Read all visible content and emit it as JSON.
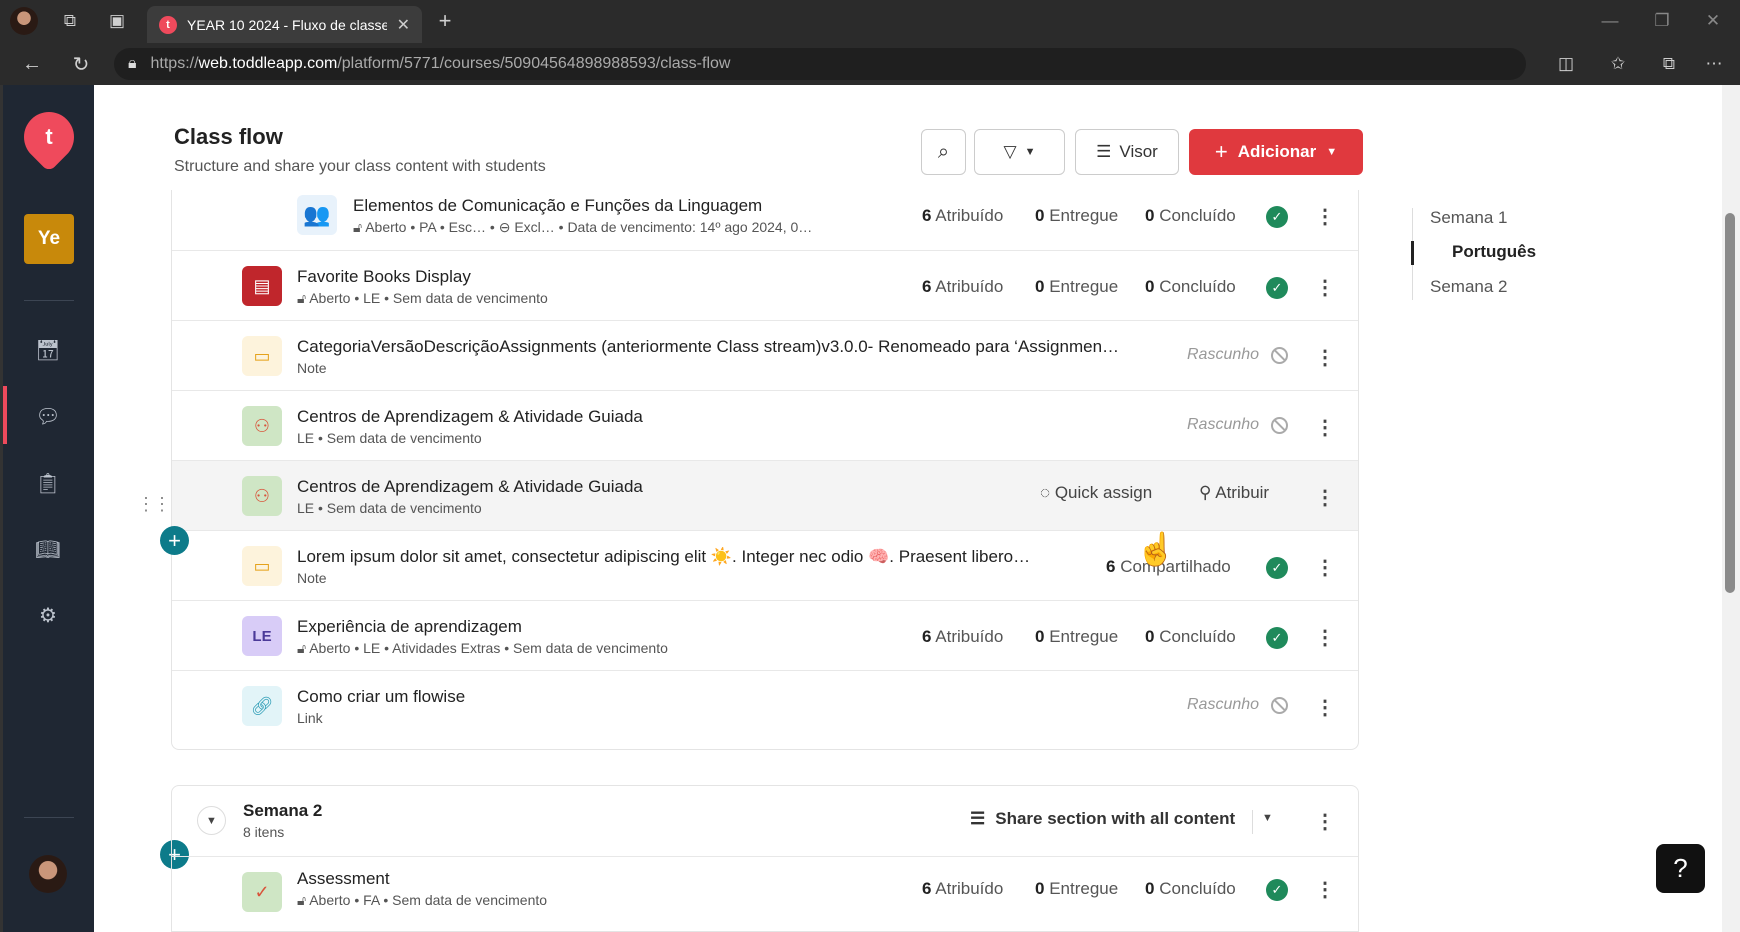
{
  "browser": {
    "tab_title": "YEAR 10 2024 - Fluxo de classe",
    "tab_favicon": "t",
    "url_prefix": "https://",
    "url_host": "web.toddleapp.com",
    "url_path": "/platform/5771/courses/50904564898988593/class-flow"
  },
  "sidebar": {
    "logo": "t",
    "course_badge": "Ye",
    "items": [
      "calendar-icon",
      "chat-icon",
      "person-doc-icon",
      "book-icon",
      "gear-icon"
    ]
  },
  "header": {
    "title": "Class flow",
    "subtitle": "Structure and share your class content with students",
    "visor_label": "Visor",
    "add_label": "Adicionar"
  },
  "rows": [
    {
      "title": "Elementos de Comunicação e Funções da Linguagem",
      "sub": "Aberto • PA • Esc… • ⊖ Excl… • Data de vencimento: 14º ago 2024, 0…",
      "assigned": "6",
      "assigned_label": "Atribuído",
      "delivered": "0",
      "delivered_label": "Entregue",
      "done": "0",
      "done_label": "Concluído"
    },
    {
      "title": "Favorite Books Display",
      "sub": "Aberto • LE • Sem data de vencimento",
      "assigned": "6",
      "assigned_label": "Atribuído",
      "delivered": "0",
      "delivered_label": "Entregue",
      "done": "0",
      "done_label": "Concluído"
    },
    {
      "title": "CategoriaVersãoDescriçãoAssignments (anteriormente Class stream)v3.0.0- Renomeado para ‘Assignmen…",
      "sub": "Note",
      "status": "Rascunho"
    },
    {
      "title": "Centros de Aprendizagem & Atividade Guiada",
      "sub": "LE • Sem data de vencimento",
      "status": "Rascunho"
    },
    {
      "title": "Centros de Aprendizagem & Atividade Guiada",
      "sub": "LE • Sem data de vencimento",
      "quick_assign": "Quick assign",
      "assign": "Atribuir"
    },
    {
      "title": "Lorem ipsum dolor sit amet, consectetur adipiscing elit ☀️. Integer nec odio 🧠. Praesent libero…",
      "sub": "Note",
      "shared": "6",
      "shared_label": "Compartilhado"
    },
    {
      "title": "Experiência de aprendizagem",
      "sub": "Aberto • LE • Atividades Extras • Sem data de vencimento",
      "thumb": "LE",
      "assigned": "6",
      "assigned_label": "Atribuído",
      "delivered": "0",
      "delivered_label": "Entregue",
      "done": "0",
      "done_label": "Concluído"
    },
    {
      "title": "Como criar um flowise",
      "sub": "Link",
      "status": "Rascunho"
    }
  ],
  "section2": {
    "title": "Semana 2",
    "count": "8 itens",
    "share_label": "Share section with all content",
    "row": {
      "title": "Assessment",
      "sub": "Aberto • FA • Sem data de vencimento",
      "assigned": "6",
      "assigned_label": "Atribuído",
      "delivered": "0",
      "delivered_label": "Entregue",
      "done": "0",
      "done_label": "Concluído"
    }
  },
  "toc": {
    "items": [
      "Semana 1",
      "Português",
      "Semana 2"
    ]
  },
  "help": "?",
  "colors": {
    "accent": "#e0393e",
    "success": "#1f8a5b",
    "sidebar": "#1f2733",
    "plus": "#0d7b8a"
  }
}
